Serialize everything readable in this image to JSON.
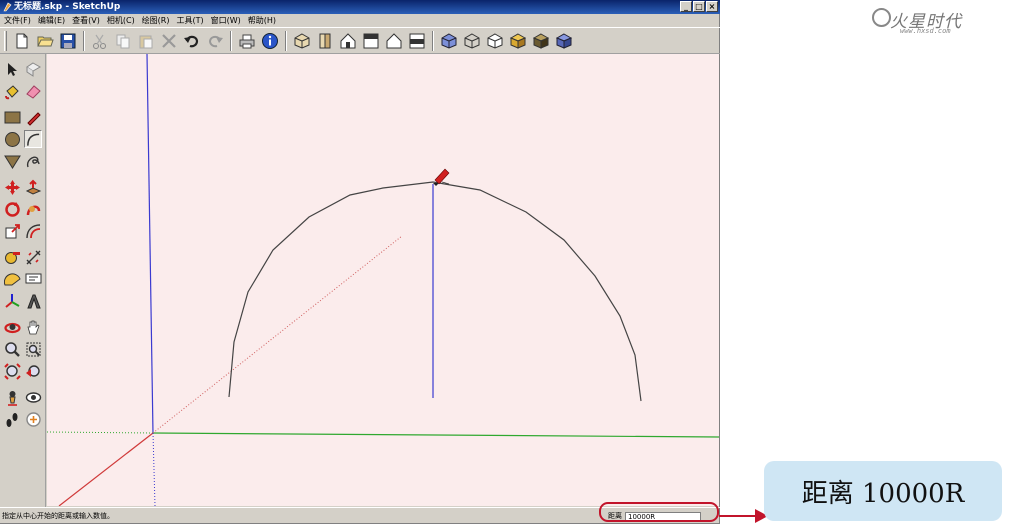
{
  "window": {
    "title": "无标题.skp - SketchUp",
    "min_glyph": "_",
    "max_glyph": "□",
    "close_glyph": "×"
  },
  "menu": [
    {
      "label": "文件(F)"
    },
    {
      "label": "编辑(E)"
    },
    {
      "label": "查看(V)"
    },
    {
      "label": "相机(C)"
    },
    {
      "label": "绘图(R)"
    },
    {
      "label": "工具(T)"
    },
    {
      "label": "窗口(W)"
    },
    {
      "label": "帮助(H)"
    }
  ],
  "status": {
    "hint": "指定从中心开始的距离或输入数值。",
    "vcb_label": "距离",
    "vcb_value": "10000R"
  },
  "callout": {
    "text": "距离 10000R"
  },
  "logo": {
    "text": "火星时代",
    "sub": "www.hxsd.com"
  },
  "colors": {
    "viewport_bg": "#fbecec",
    "blue_axis": "#3a3ad0",
    "green_axis": "#2fa82f",
    "red_axis": "#d03a3a",
    "highlight": "#c2142b",
    "callout_bg": "#cfe6f4"
  },
  "icons": {
    "toolbar": [
      "new-file-icon",
      "open-folder-icon",
      "save-icon",
      "cut-icon",
      "copy-icon",
      "paste-icon",
      "erase-x-icon",
      "undo-icon",
      "redo-icon",
      "print-icon",
      "model-info-icon",
      "iso-view-icon",
      "top-view-icon",
      "front-view-icon",
      "right-view-icon",
      "back-view-icon",
      "left-view-icon",
      "xray-style-icon",
      "wireframe-style-icon",
      "hidden-line-style-icon",
      "shaded-style-icon",
      "textured-style-icon",
      "monochrome-style-icon"
    ],
    "tools": [
      "select-icon",
      "make-component-icon",
      "paint-bucket-icon",
      "eraser-icon",
      "rectangle-icon",
      "line-pencil-icon",
      "circle-icon",
      "arc-icon",
      "polygon-icon",
      "freehand-icon",
      "move-icon",
      "push-pull-icon",
      "rotate-icon",
      "follow-me-icon",
      "scale-icon",
      "offset-icon",
      "tape-measure-icon",
      "dimension-icon",
      "protractor-icon",
      "text-icon",
      "axes-icon",
      "3d-text-icon",
      "orbit-icon",
      "pan-icon",
      "zoom-icon",
      "zoom-window-icon",
      "zoom-extents-icon",
      "previous-view-icon",
      "position-camera-icon",
      "look-around-icon",
      "walk-icon",
      "section-plane-icon"
    ]
  }
}
